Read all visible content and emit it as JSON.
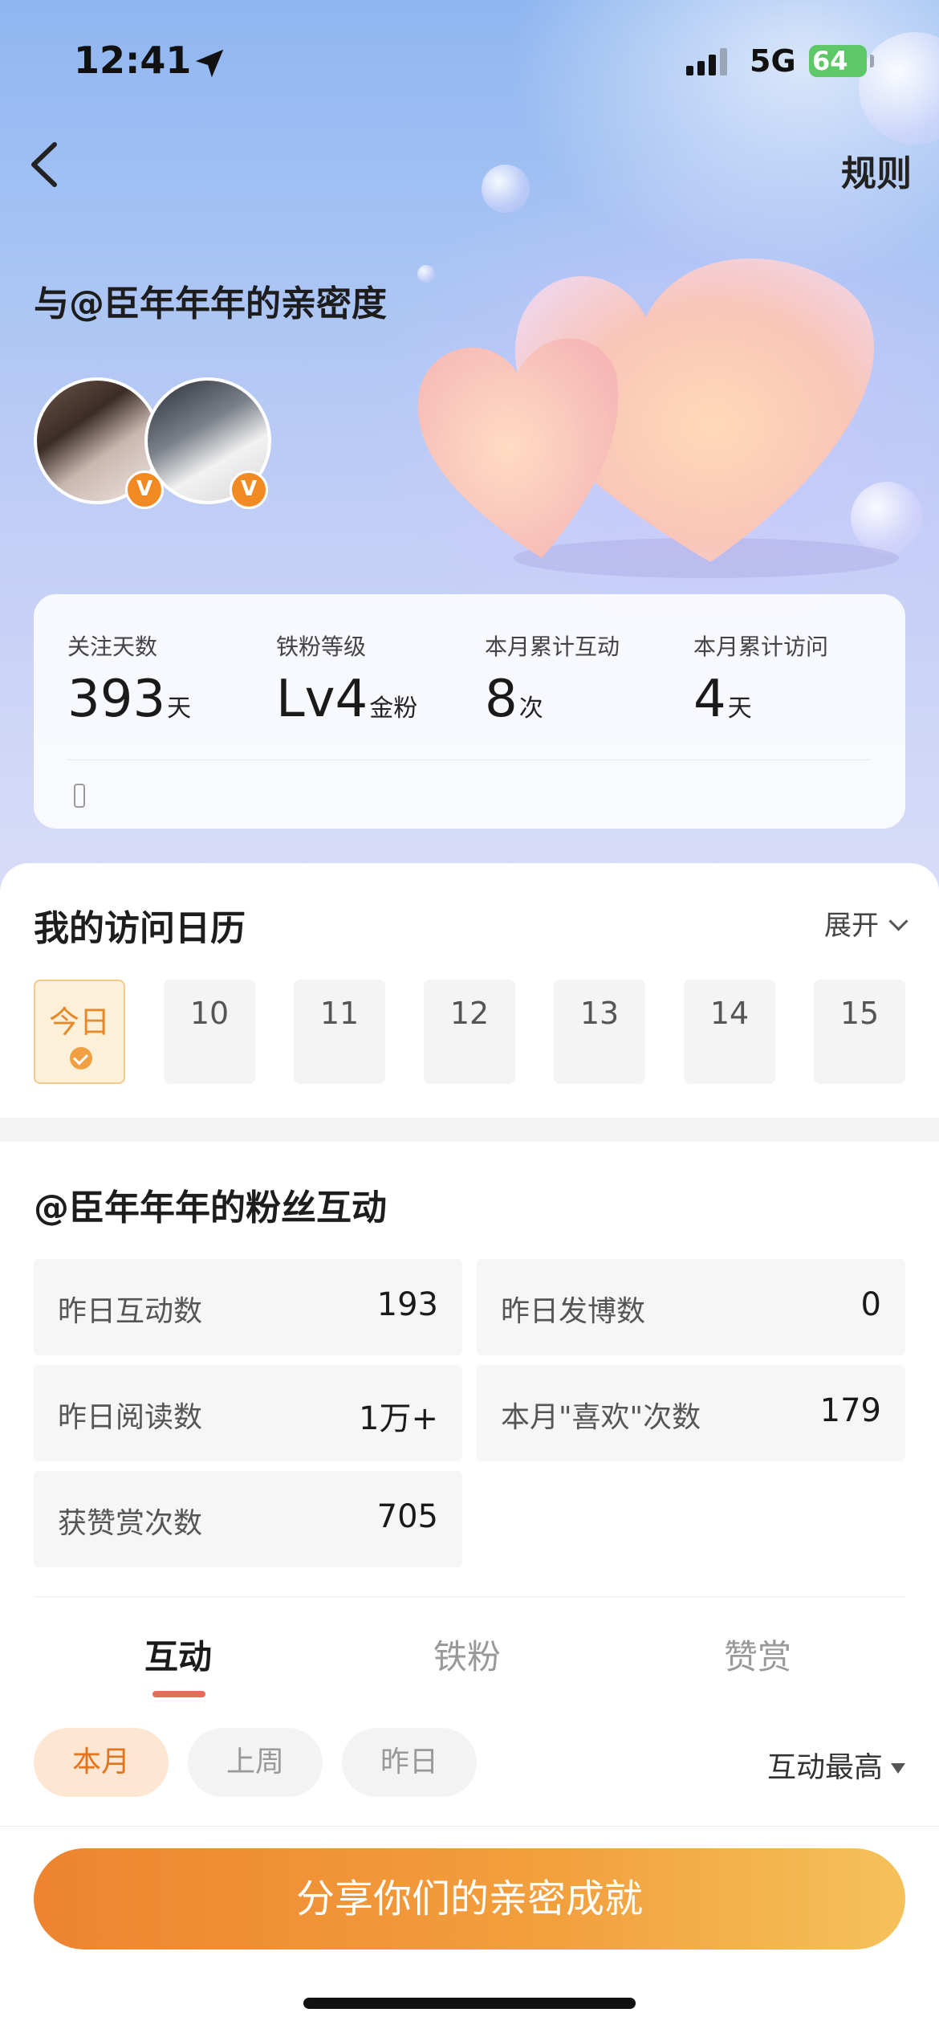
{
  "status_bar": {
    "time": "12:41",
    "network": "5G",
    "battery": "64"
  },
  "header": {
    "rules_label": "规则",
    "title": "与@臣年年年的亲密度"
  },
  "avatars": {
    "badge_1": "V",
    "badge_2": "V"
  },
  "stats": [
    {
      "label": "关注天数",
      "value": "393",
      "unit": "天"
    },
    {
      "label": "铁粉等级",
      "value": "Lv4",
      "unit": "金粉"
    },
    {
      "label": "本月累计互动",
      "value": "8",
      "unit": "次"
    },
    {
      "label": "本月累计访问",
      "value": "4",
      "unit": "天"
    }
  ],
  "calendar": {
    "title": "我的访问日历",
    "expand_label": "展开",
    "days": [
      "今日",
      "10",
      "11",
      "12",
      "13",
      "14",
      "15"
    ]
  },
  "fans": {
    "title": "@臣年年年的粉丝互动",
    "metrics": [
      {
        "label": "昨日互动数",
        "value": "193"
      },
      {
        "label": "昨日发博数",
        "value": "0"
      },
      {
        "label": "昨日阅读数",
        "value": "1万+"
      },
      {
        "label": "本月\"喜欢\"次数",
        "value": "179"
      },
      {
        "label": "获赞赏次数",
        "value": "705"
      }
    ]
  },
  "tabs": [
    "互动",
    "铁粉",
    "赞赏"
  ],
  "filters": [
    "本月",
    "上周",
    "昨日"
  ],
  "sort_label": "互动最高",
  "share_button": "分享你们的亲密成就",
  "colors": {
    "accent_orange": "#f28a23",
    "tab_underline": "#ea6a5a",
    "share_gradient_start": "#ee8430",
    "share_gradient_end": "#f5c15b"
  }
}
